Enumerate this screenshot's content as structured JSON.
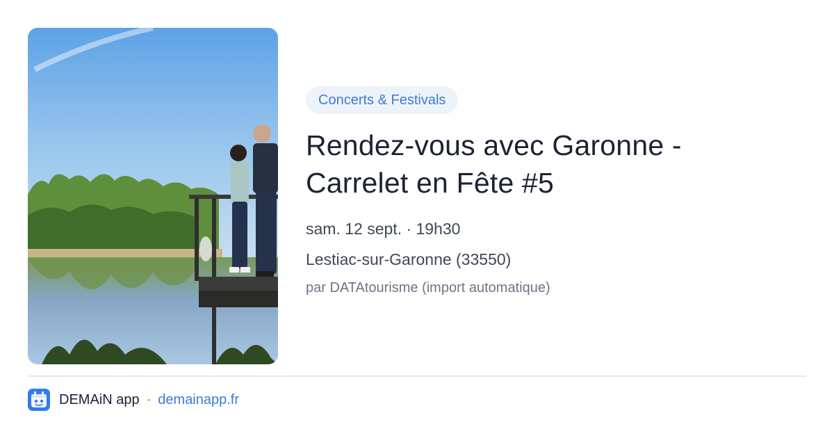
{
  "event": {
    "category": "Concerts & Festivals",
    "title_line1": "Rendez-vous avec Garonne -",
    "title_line2": "Carrelet en Fête #5",
    "datetime": "sam. 12 sept. · 19h30",
    "location": "Lestiac-sur-Garonne (33550)",
    "source": "par DATAtourisme (import automatique)"
  },
  "footer": {
    "app_name": "DEMAiN app",
    "separator": "·",
    "site": "demainapp.fr"
  },
  "colors": {
    "accent": "#3d7dd0",
    "chip_bg": "#eef3fa",
    "title": "#1b2233",
    "text": "#3f4756",
    "muted": "#6d7584",
    "divider": "#e3e8ee"
  },
  "icons": {
    "app": "demain-app-icon"
  }
}
